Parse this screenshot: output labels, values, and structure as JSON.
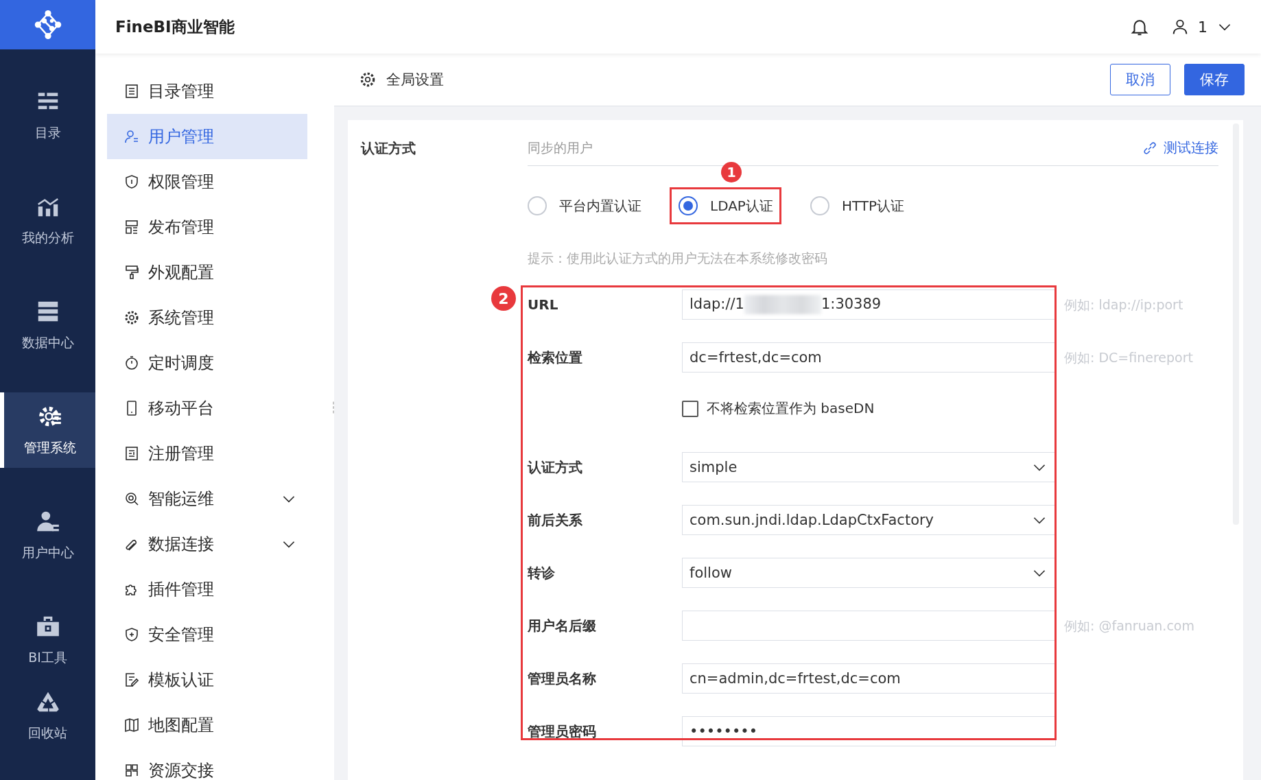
{
  "app": {
    "title": "FineBI商业智能",
    "user": "1"
  },
  "nav": [
    {
      "label": "目录",
      "selected": false
    },
    {
      "label": "我的分析",
      "selected": false
    },
    {
      "label": "数据中心",
      "selected": false
    },
    {
      "label": "管理系统",
      "selected": true
    },
    {
      "label": "用户中心",
      "selected": false
    },
    {
      "label": "BI工具",
      "selected": false
    },
    {
      "label": "回收站",
      "selected": false
    }
  ],
  "sidebar": [
    {
      "label": "目录管理",
      "selected": false,
      "kind": "link"
    },
    {
      "label": "用户管理",
      "selected": true,
      "kind": "link"
    },
    {
      "label": "权限管理",
      "selected": false,
      "kind": "link"
    },
    {
      "label": "发布管理",
      "selected": false,
      "kind": "link"
    },
    {
      "label": "外观配置",
      "selected": false,
      "kind": "link"
    },
    {
      "label": "系统管理",
      "selected": false,
      "kind": "link"
    },
    {
      "label": "定时调度",
      "selected": false,
      "kind": "link"
    },
    {
      "label": "移动平台",
      "selected": false,
      "kind": "link"
    },
    {
      "label": "注册管理",
      "selected": false,
      "kind": "link"
    },
    {
      "label": "智能运维",
      "selected": false,
      "kind": "group",
      "expanded": false
    },
    {
      "label": "数据连接",
      "selected": false,
      "kind": "group",
      "expanded": false
    },
    {
      "label": "插件管理",
      "selected": false,
      "kind": "link"
    },
    {
      "label": "安全管理",
      "selected": false,
      "kind": "link"
    },
    {
      "label": "模板认证",
      "selected": false,
      "kind": "link"
    },
    {
      "label": "地图配置",
      "selected": false,
      "kind": "link"
    },
    {
      "label": "资源交接",
      "selected": false,
      "kind": "link"
    }
  ],
  "toolbar": {
    "title": "全局设置",
    "buttons": [
      {
        "label": "取消",
        "kind": "secondary"
      },
      {
        "label": "保存",
        "kind": "primary"
      }
    ]
  },
  "auth": {
    "label": "认证方式",
    "tab": "同步的用户",
    "test_link": "测试连接",
    "options": [
      {
        "label": "平台内置认证",
        "selected": false
      },
      {
        "label": "LDAP认证",
        "selected": true,
        "callout": "1"
      },
      {
        "label": "HTTP认证",
        "selected": false
      }
    ],
    "hint": "提示：使用此认证方式的用户无法在本系统修改密码",
    "fields_callout": "2",
    "fields": [
      {
        "kind": "text",
        "label": "URL",
        "value_parts": [
          "ldap://1",
          "1:30389"
        ],
        "redacted": true,
        "example": "例如: ldap://ip:port"
      },
      {
        "kind": "text",
        "label": "检索位置",
        "value_parts": [
          "dc=frtest,dc=com"
        ],
        "example": "例如: DC=finereport"
      },
      {
        "kind": "checkbox",
        "label": "不将检索位置作为 baseDN",
        "checked": false
      },
      {
        "kind": "select",
        "label": "认证方式",
        "value": "simple"
      },
      {
        "kind": "select",
        "label": "前后关系",
        "value": "com.sun.jndi.ldap.LdapCtxFactory"
      },
      {
        "kind": "select",
        "label": "转诊",
        "value": "follow"
      },
      {
        "kind": "text",
        "label": "用户名后缀",
        "example": "例如: @fanruan.com"
      },
      {
        "kind": "text",
        "label": "管理员名称",
        "value_parts": [
          "cn=admin,dc=frtest,dc=com"
        ]
      },
      {
        "kind": "text",
        "label": "管理员密码",
        "value_parts": [
          "••••••••"
        ]
      }
    ]
  }
}
